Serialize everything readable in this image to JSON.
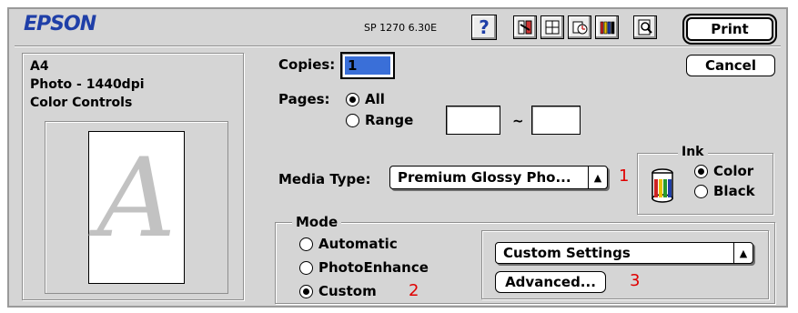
{
  "header": {
    "brand": "EPSON",
    "version": "SP 1270 6.30E",
    "help_label": "?"
  },
  "actions": {
    "print_label": "Print",
    "cancel_label": "Cancel"
  },
  "summary": {
    "paper": "A4",
    "quality": "Photo - 1440dpi",
    "color": "Color Controls",
    "preview_letter": "A"
  },
  "copies": {
    "label": "Copies:",
    "value": "1"
  },
  "pages": {
    "label": "Pages:",
    "all_label": "All",
    "range_label": "Range",
    "range_from": "",
    "range_to": "",
    "separator": "~",
    "selected": "All"
  },
  "media": {
    "label": "Media Type:",
    "value": "Premium Glossy Pho...",
    "callout": "1"
  },
  "ink": {
    "title": "Ink",
    "color_label": "Color",
    "black_label": "Black",
    "selected": "Color"
  },
  "mode": {
    "title": "Mode",
    "automatic_label": "Automatic",
    "photoenhance_label": "PhotoEnhance",
    "custom_label": "Custom",
    "selected": "Custom",
    "callout_custom": "2",
    "custom_settings_value": "Custom Settings",
    "advanced_label": "Advanced...",
    "callout_advanced": "3"
  },
  "icons": [
    "help-icon",
    "utility-icon",
    "layout-icon",
    "background-printing-icon",
    "ink-levels-icon",
    "preview-icon",
    "ink-cartridge-icon"
  ],
  "colors": {
    "brand_blue": "#1f3fa8",
    "dialog_bg": "#d5d5d5",
    "callout_red": "#e00000",
    "copies_field_bg": "#3a6fd8"
  }
}
